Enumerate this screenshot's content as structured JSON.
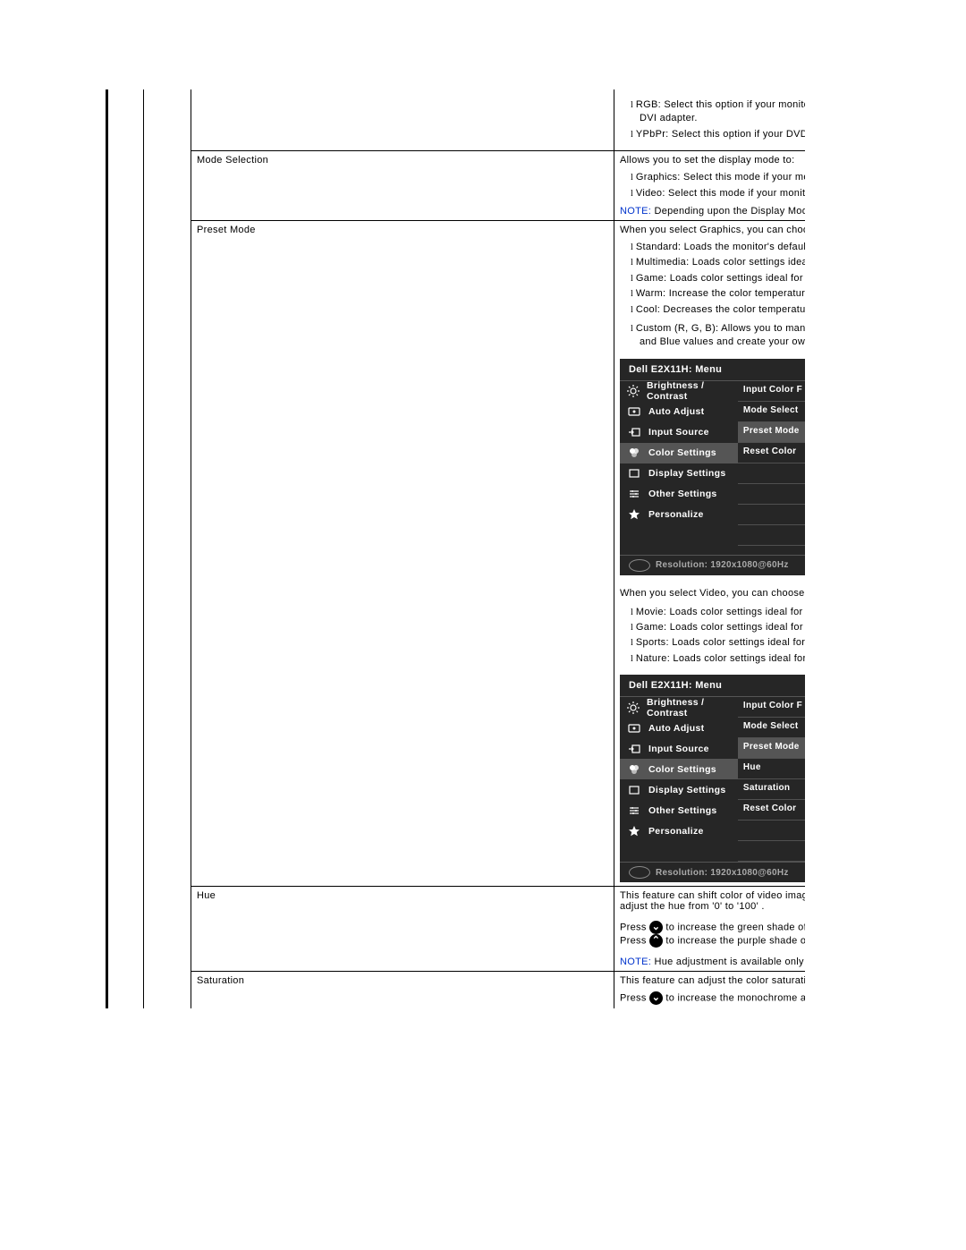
{
  "rows": {
    "pre": {
      "bullets": [
        "RGB: Select this option if your monitor",
        "YPbPr: Select this option if your DVD p"
      ],
      "dvi": "DVI adapter."
    },
    "modeSelection": {
      "label": "Mode Selection",
      "desc": "Allows you to set the display mode to:",
      "bullets": [
        "Graphics: Select this mode if your mon",
        "Video: Select this mode if your monitor"
      ],
      "note_pre": "NOTE:",
      "note": " Depending upon the Display Mode you"
    },
    "presetMode": {
      "label": "Preset Mode",
      "desc1": "When you select Graphics, you can choose S",
      "bullets1": [
        "Standard: Loads the monitor's default",
        "Multimedia: Loads color settings ideal",
        "Game: Loads color settings ideal for m",
        "Warm: Increase the color temperature",
        "Cool: Decreases the color temperature"
      ],
      "bullets1b": [
        "Custom (R, G, B): Allows you to manu"
      ],
      "bullets1b_line2": "and Blue values and create your own p",
      "desc2": "When you select Video, you can choose Movi",
      "bullets2": [
        "Movie: Loads color settings ideal for m",
        "Game: Loads color settings ideal for ga",
        "Sports: Loads color settings ideal for s",
        "Nature: Loads color settings ideal for n"
      ]
    },
    "hue": {
      "label": "Hue",
      "desc": "This feature can shift color of video image to",
      "desc2": "adjust the hue from '0' to '100' .",
      "press1a": "Press ",
      "press1b": " to increase the green shade of the",
      "press2a": "Press ",
      "press2b": " to increase the purple shade of the",
      "note_pre": "NOTE:",
      "note": " Hue adjustment is available only for v"
    },
    "saturation": {
      "label": "Saturation",
      "desc": "This feature can adjust the color saturation o",
      "press1a": "Press ",
      "press1b": " to increase the monochrome appea"
    }
  },
  "osd": {
    "title": "Dell E2X11H: Menu",
    "left": [
      {
        "icon": "sun",
        "label": "Brightness / Contrast"
      },
      {
        "icon": "target",
        "label": "Auto Adjust"
      },
      {
        "icon": "input",
        "label": "Input Source"
      },
      {
        "icon": "palette",
        "label": "Color Settings",
        "sel": true
      },
      {
        "icon": "screen",
        "label": "Display Settings"
      },
      {
        "icon": "sliders",
        "label": "Other Settings"
      },
      {
        "icon": "star",
        "label": "Personalize"
      }
    ],
    "right1": [
      "Input Color F",
      "Mode Select",
      "Preset Mode",
      "Reset Color",
      "",
      "",
      "",
      ""
    ],
    "right1_sel": 2,
    "right2": [
      "Input Color F",
      "Mode Select",
      "Preset Mode",
      "Hue",
      "Saturation",
      "Reset Color",
      "",
      ""
    ],
    "right2_sel": 2,
    "resolution": "Resolution: 1920x1080@60Hz"
  }
}
